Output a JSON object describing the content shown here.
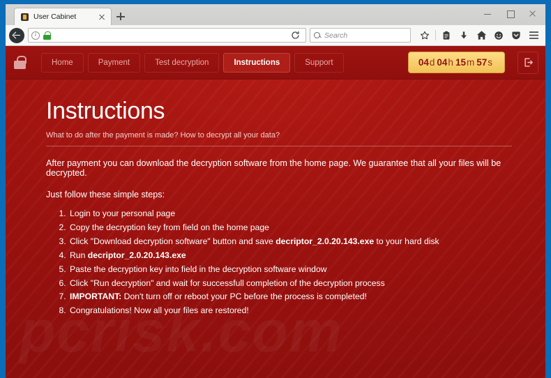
{
  "browser": {
    "tab": {
      "title": "User Cabinet",
      "favicon": "padlock-favicon"
    },
    "newtab_label": "+",
    "url": "",
    "search_placeholder": "Search",
    "window_controls": {
      "minimize": "–",
      "maximize": "□",
      "close": "×"
    },
    "toolbar_icons": [
      "bookmark-star-icon",
      "library-icon",
      "downloads-icon",
      "home-icon",
      "account-icon",
      "pocket-icon",
      "menu-icon"
    ]
  },
  "site": {
    "brand_icon": "padlock-icon",
    "nav": [
      {
        "label": "Home",
        "active": false
      },
      {
        "label": "Payment",
        "active": false
      },
      {
        "label": "Test decryption",
        "active": false
      },
      {
        "label": "Instructions",
        "active": true
      },
      {
        "label": "Support",
        "active": false
      }
    ],
    "timer": {
      "days": "04",
      "days_unit": "d",
      "hours": "04",
      "hours_unit": "h",
      "minutes": "15",
      "minutes_unit": "m",
      "seconds": "57",
      "seconds_unit": "s"
    },
    "logout_icon": "logout-icon",
    "watermark": "pcrisk.com",
    "colors": {
      "page_red": "#a81613",
      "navbar_red": "#9d1411",
      "active_nav_red": "#ad1f18",
      "timer_gold": "#f6cb6a",
      "timer_text": "#8e1410",
      "desktop_blue": "#0b6cb8"
    }
  },
  "content": {
    "title": "Instructions",
    "subtitle": "What to do after the payment is made? How to decrypt all your data?",
    "lead": "After payment you can download the decryption software from the home page. We guarantee that all your files will be decrypted.",
    "lead2": "Just follow these simple steps:",
    "steps": [
      {
        "pre": "Login to your personal page",
        "bold": "",
        "post": ""
      },
      {
        "pre": "Copy the decryption key from field on the home page",
        "bold": "",
        "post": ""
      },
      {
        "pre": "Click \"Download decryption software\" button and save ",
        "bold": "decriptor_2.0.20.143.exe",
        "post": " to your hard disk"
      },
      {
        "pre": "Run ",
        "bold": "decriptor_2.0.20.143.exe",
        "post": ""
      },
      {
        "pre": "Paste the decryption key into field in the decryption software window",
        "bold": "",
        "post": ""
      },
      {
        "pre": "Click \"Run decryption\" and wait for successfull completion of the decryption process",
        "bold": "",
        "post": ""
      },
      {
        "pre": "",
        "bold": "IMPORTANT:",
        "post": " Don't turn off or reboot your PC before the process is completed!"
      },
      {
        "pre": "Congratulations! Now all your files are restored!",
        "bold": "",
        "post": ""
      }
    ]
  }
}
